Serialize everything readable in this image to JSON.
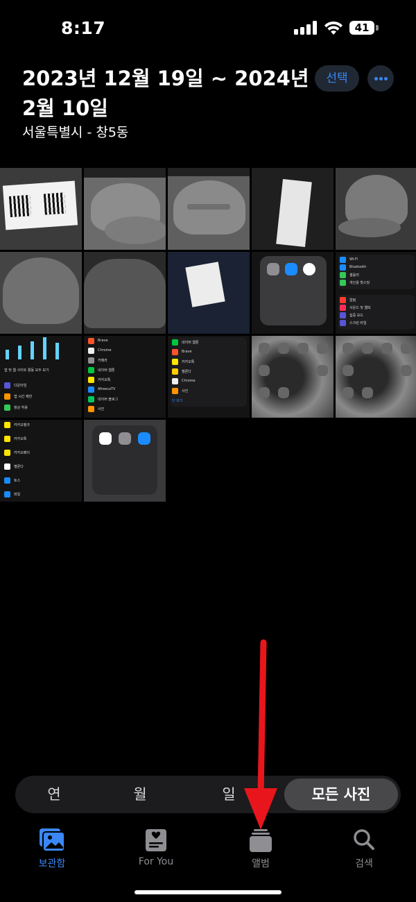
{
  "status_bar": {
    "time": "8:17",
    "battery": "41"
  },
  "header": {
    "title": "2023년 12월 19일 ~ 2024년 2월 10일",
    "subtitle": "서울특별시 - 창5동",
    "select_label": "선택"
  },
  "photos": [
    {
      "name": "photo-qr-label"
    },
    {
      "name": "photo-gray-cap"
    },
    {
      "name": "photo-timberland-cap"
    },
    {
      "name": "photo-cap-tag"
    },
    {
      "name": "photo-whale-cap"
    },
    {
      "name": "photo-cap-side"
    },
    {
      "name": "photo-cap-inside"
    },
    {
      "name": "photo-vineyard-tag"
    },
    {
      "name": "photo-settings-folder"
    },
    {
      "name": "photo-settings-list"
    },
    {
      "name": "photo-screen-time"
    },
    {
      "name": "photo-app-list-1"
    },
    {
      "name": "photo-app-list-2"
    },
    {
      "name": "photo-homescreen-1"
    },
    {
      "name": "photo-homescreen-2"
    },
    {
      "name": "photo-app-list-3"
    },
    {
      "name": "photo-apps-folder"
    }
  ],
  "screenshot_text": {
    "settings_folder": {
      "app1": "설정",
      "app2": "App Store",
      "app3": "시계"
    },
    "settings_list": {
      "r1": "Wi-Fi",
      "r2": "Bluetooth",
      "r3": "셀룰러",
      "r4": "개인용 핫스팟",
      "r5": "알림",
      "r6": "사운드 및 햅틱",
      "r7": "집중 모드",
      "r8": "스크린 타임"
    },
    "screen_time": {
      "r1": "앱 및 웹 사이트 활동 모두 보기",
      "r2": "다운타임",
      "r3": "앱 시간 제한",
      "r4": "항상 허용"
    },
    "app_list_1": {
      "r1": "Brave",
      "r2": "Chrome",
      "r3": "카메라",
      "r4": "네이버 웹툰",
      "r5": "카카오톡",
      "r6": "AfreecaTV",
      "r7": "네이버 블로그",
      "r8": "사진"
    },
    "app_list_2": {
      "r1": "네이버 웹툰",
      "r2": "Brave",
      "r3": "카카오톡",
      "r4": "멜론다",
      "r5": "Chrome",
      "r6": "사진",
      "r7": "더 보기"
    },
    "app_list_3": {
      "r1": "카카오뱅크",
      "r2": "카카오톡",
      "r3": "카카오페이",
      "r4": "멜론다",
      "r5": "토스",
      "r6": "파일"
    },
    "apps_folder": {
      "app1": "사진",
      "app2": "카메라",
      "app3": "파일"
    }
  },
  "segmented": {
    "year": "연",
    "month": "월",
    "day": "일",
    "all": "모든 사진"
  },
  "tabs": {
    "library": "보관함",
    "for_you": "For You",
    "albums": "앨범",
    "search": "검색"
  },
  "colors": {
    "accent": "#3a87f5",
    "arrow": "#e8161c"
  }
}
